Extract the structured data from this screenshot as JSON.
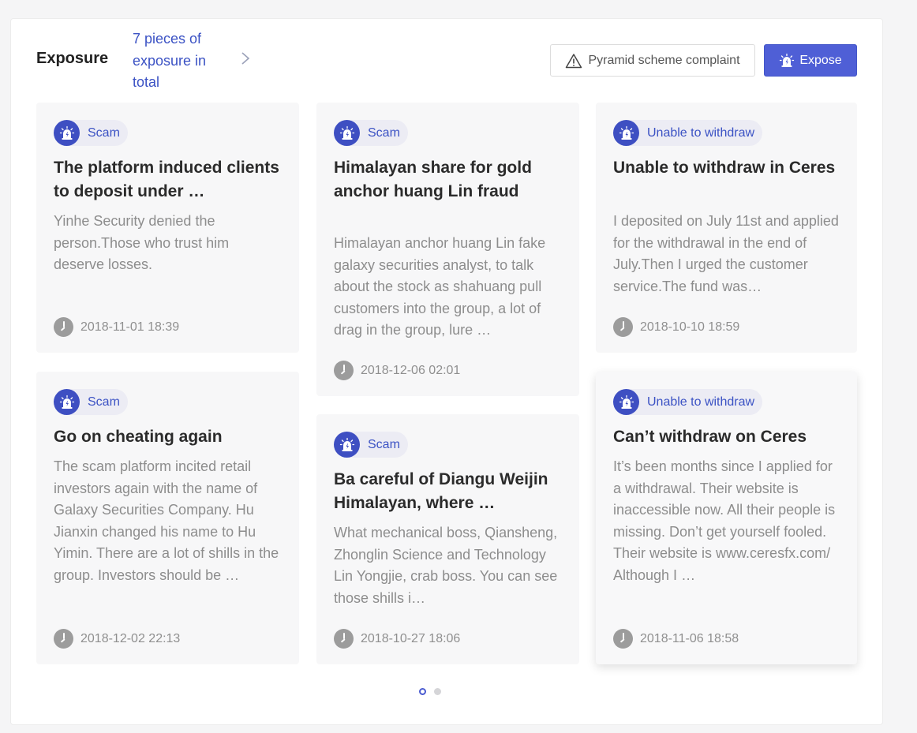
{
  "header": {
    "title": "Exposure",
    "count_link": "7 pieces of exposure in total",
    "complaint_button": "Pyramid scheme complaint",
    "expose_button": "Expose"
  },
  "colors": {
    "accent": "#4f5fd6",
    "tag_icon": "#3e4fc2",
    "link": "#3b52c4"
  },
  "cards": [
    {
      "tag": "Scam",
      "title": "The platform induced clients to deposit under …",
      "description": "Yinhe Security denied the person.Those who trust him deserve losses.",
      "date": "2018-11-01 18:39"
    },
    {
      "tag": "Scam",
      "title": "Go on cheating again",
      "description": "The scam platform incited retail investors again with the name of Galaxy Securities Company. Hu Jianxin changed his name to Hu Yimin. There are a lot of shills in the group. Investors should be …",
      "date": "2018-12-02 22:13"
    },
    {
      "tag": "Scam",
      "title": "Himalayan share for gold anchor huang Lin fraud",
      "description": "Himalayan anchor huang Lin fake galaxy securities analyst, to talk about the stock as shahuang pull customers into the group, a lot of drag in the group, lure …",
      "date": "2018-12-06 02:01"
    },
    {
      "tag": "Scam",
      "title": "Ba careful of Diangu Weijin Himalayan, where …",
      "description": "What mechanical boss, Qiansheng, Zhonglin Science and Technology Lin Yongjie, crab boss. You can see those shills i…",
      "date": "2018-10-27 18:06"
    },
    {
      "tag": "Unable to withdraw",
      "title": "Unable to withdraw in Ceres",
      "description": "I deposited on July 11st and applied for the withdrawal in the end of July.Then I urged the customer service.The fund was…",
      "date": "2018-10-10 18:59"
    },
    {
      "tag": "Unable to withdraw",
      "title": "Can’t withdraw on Ceres",
      "description": "It’s been months since I applied for a withdrawal. Their website is inaccessible now. All their people is missing. Don’t get yourself fooled. Their website is www.ceresfx.com/ Although I …",
      "date": "2018-11-06 18:58"
    }
  ],
  "pagination": {
    "current_page": 1,
    "total_pages": 2
  }
}
